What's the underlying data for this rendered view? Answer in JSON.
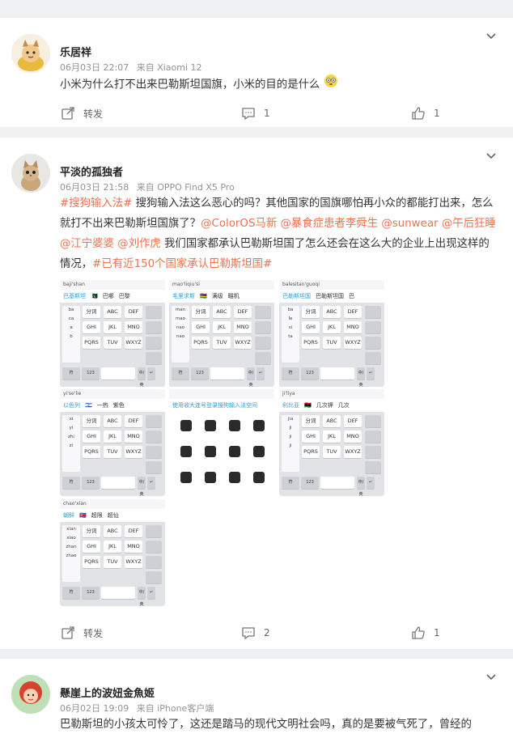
{
  "comments": [
    {
      "username": "乐居祥",
      "date": "06月03日 22:07",
      "source": "来自 Xiaomi 12",
      "text": "小米为什么打不出来巴勒斯坦国旗，小米的目的是什么",
      "emoji_name": "dizzy-face-emoji",
      "repost_label": "转发",
      "comment_count": "1",
      "like_count": "1"
    },
    {
      "username": "平淡的孤独者",
      "date": "06月03日 21:58",
      "source": "来自 OPPO Find X5 Pro",
      "text_parts": [
        {
          "t": "#搜狗输入法#",
          "tag": true
        },
        {
          "t": " 搜狗输入法这么恶心的吗？其他国家的国旗哪怕再小众的都能打出来，怎么就打不出来巴勒斯坦国旗了？",
          "tag": false
        },
        {
          "t": "@ColorOS马新",
          "tag": true
        },
        {
          "t": " ",
          "tag": false
        },
        {
          "t": "@暴食症患者李舜生",
          "tag": true
        },
        {
          "t": " ",
          "tag": false
        },
        {
          "t": "@sunwear",
          "tag": true
        },
        {
          "t": " ",
          "tag": false
        },
        {
          "t": "@午后狂睡",
          "tag": true
        },
        {
          "t": " ",
          "tag": false
        },
        {
          "t": "@江宁婆婆",
          "tag": true
        },
        {
          "t": " ",
          "tag": false
        },
        {
          "t": "@刘作虎",
          "tag": true
        },
        {
          "t": " 我们国家都承认巴勒斯坦国了怎么还会在这么大的企业上出现这样的情况，",
          "tag": false
        },
        {
          "t": "#已有近150个国家承认巴勒斯坦国#",
          "tag": true
        }
      ],
      "thumbnails": [
        {
          "pinyin": "baji'shan",
          "cand": [
            "巴基斯坦",
            "🇵🇰",
            "巴哪",
            "巴黎"
          ],
          "left": [
            "ba",
            "ca",
            "a",
            "b"
          ]
        },
        {
          "pinyin": "mao'liqiu'si",
          "cand": [
            "毛里求斯",
            "🇲🇺",
            "满级",
            "瞄机"
          ],
          "left": [
            "man",
            "mao",
            "nao",
            "nao"
          ]
        },
        {
          "pinyin": "balesitan'guoqi",
          "cand": [
            "巴勒斯坦国",
            "巴勒斯坦国",
            "巴"
          ],
          "left": [
            "ba",
            "le",
            "si",
            "ta"
          ]
        },
        {
          "pinyin": "yi'se'lie",
          "cand": [
            "以色列",
            "🇮🇱",
            "一热",
            "紫色"
          ],
          "left": [
            "xi",
            "yi",
            "zhi",
            "zi"
          ]
        },
        {
          "pinyin": "",
          "cand": [
            "使用收大连号登录搜狗输入法空间"
          ],
          "left": []
        },
        {
          "pinyin": "ji'liya",
          "cand": [
            "利比亚",
            "🇱🇾",
            "几次钾",
            "几次"
          ],
          "left": [
            "jia",
            "ji",
            "ji",
            "ji"
          ]
        },
        {
          "pinyin": "chao'xian",
          "cand": [
            "朝鲜",
            "🇰🇵",
            "超限",
            "超仙"
          ],
          "left": [
            "xian",
            "xiao",
            "zhan",
            "zhao"
          ]
        }
      ],
      "key_labels": [
        "分词",
        "ABC",
        "DEF",
        "GHI",
        "JKL",
        "MNO",
        "PQRS",
        "TUV",
        "WXYZ",
        "符",
        "123",
        "中/英",
        "↵"
      ],
      "repost_label": "转发",
      "comment_count": "2",
      "like_count": "1"
    },
    {
      "username": "懸崖上的波妞金魚姬",
      "date": "06月02日 19:09",
      "source": "来自 iPhone客户端",
      "text": "巴勒斯坦的小孩太可怜了，这还是踏马的现代文明社会吗，真的是要被气死了，曾经的"
    }
  ]
}
